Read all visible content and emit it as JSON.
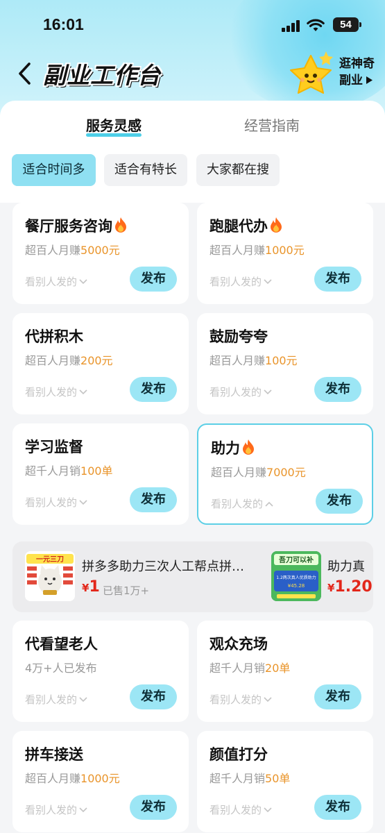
{
  "status": {
    "time": "16:01",
    "battery": "54"
  },
  "header": {
    "title": "副业工作台",
    "promo_line1": "逛神奇",
    "promo_line2": "副业"
  },
  "tabs": [
    {
      "label": "服务灵感",
      "active": true
    },
    {
      "label": "经营指南",
      "active": false
    }
  ],
  "filters": [
    {
      "label": "适合时间多",
      "active": true
    },
    {
      "label": "适合有特长",
      "active": false
    },
    {
      "label": "大家都在搜",
      "active": false
    }
  ],
  "cards": [
    {
      "title": "餐厅服务咨询",
      "hot": true,
      "sub_prefix": "超百人月赚",
      "sub_value": "5000元",
      "see_more": "看别人发的",
      "button": "发布"
    },
    {
      "title": "跑腿代办",
      "hot": true,
      "sub_prefix": "超百人月赚",
      "sub_value": "1000元",
      "see_more": "看别人发的",
      "button": "发布"
    },
    {
      "title": "代拼积木",
      "hot": false,
      "sub_prefix": "超百人月赚",
      "sub_value": "200元",
      "see_more": "看别人发的",
      "button": "发布"
    },
    {
      "title": "鼓励夸夸",
      "hot": false,
      "sub_prefix": "超百人月赚",
      "sub_value": "100元",
      "see_more": "看别人发的",
      "button": "发布"
    },
    {
      "title": "学习监督",
      "hot": false,
      "sub_prefix": "超千人月销",
      "sub_value": "100单",
      "see_more": "看别人发的",
      "button": "发布"
    },
    {
      "title": "助力",
      "hot": true,
      "selected": true,
      "sub_prefix": "超百人月赚",
      "sub_value": "7000元",
      "see_more": "看别人发的",
      "button": "发布"
    },
    {
      "title": "代看望老人",
      "hot": false,
      "sub_prefix": "4万+人已发布",
      "sub_value": "",
      "see_more": "看别人发的",
      "button": "发布"
    },
    {
      "title": "观众充场",
      "hot": false,
      "sub_prefix": "超千人月销",
      "sub_value": "20单",
      "see_more": "看别人发的",
      "button": "发布"
    },
    {
      "title": "拼车接送",
      "hot": false,
      "sub_prefix": "超百人月赚",
      "sub_value": "1000元",
      "see_more": "看别人发的",
      "button": "发布"
    },
    {
      "title": "颜值打分",
      "hot": false,
      "sub_prefix": "超千人月销",
      "sub_value": "50单",
      "see_more": "看别人发的",
      "button": "发布"
    }
  ],
  "products": [
    {
      "title": "拼多多助力三次人工帮点拼…",
      "price_symbol": "¥",
      "price": "1",
      "sold": "已售1万+",
      "thumb_text": "一元三刀"
    },
    {
      "title": "助力真",
      "price_symbol": "¥",
      "price": "1.20",
      "sold": "",
      "thumb_text": "吾刀可以补",
      "thumb_sub": "1.2两次真人优质助力",
      "thumb_price": "¥45.28"
    }
  ],
  "colors": {
    "accent": "#4ecfe8",
    "chip_active": "#8fe0f2",
    "button": "#9ce6f5",
    "highlight": "#e9942a",
    "price": "#e2261a"
  },
  "icons": [
    "back-arrow-icon",
    "signal-icon",
    "wifi-icon",
    "battery-icon",
    "star-mascot-icon",
    "play-triangle-icon",
    "fire-icon",
    "chevron-down-icon",
    "chevron-up-icon"
  ]
}
